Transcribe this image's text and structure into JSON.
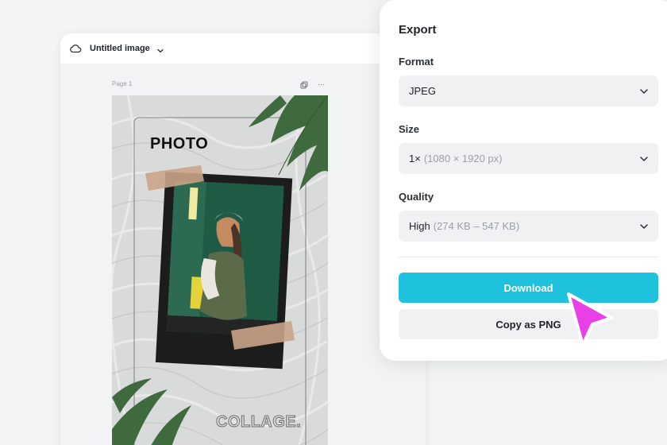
{
  "editor": {
    "title": "Untitled image",
    "page_label": "Page 1",
    "more_glyph": "…",
    "design": {
      "heading_top": "PHOTO",
      "heading_bottom": "COLLAGE."
    }
  },
  "export_panel": {
    "title": "Export",
    "format": {
      "label": "Format",
      "value": "JPEG"
    },
    "size": {
      "label": "Size",
      "value": "1×",
      "detail": "(1080 × 1920 px)"
    },
    "quality": {
      "label": "Quality",
      "value": "High",
      "detail": "(274 KB – 547 KB)"
    },
    "download_label": "Download",
    "copy_label": "Copy as PNG"
  },
  "colors": {
    "accent": "#1fc2dc",
    "cursor": "#e93fe6"
  },
  "icons": [
    "cloud-icon",
    "chevron-down-icon",
    "duplicate-page-icon",
    "more-options-icon",
    "pointer-cursor-icon"
  ]
}
